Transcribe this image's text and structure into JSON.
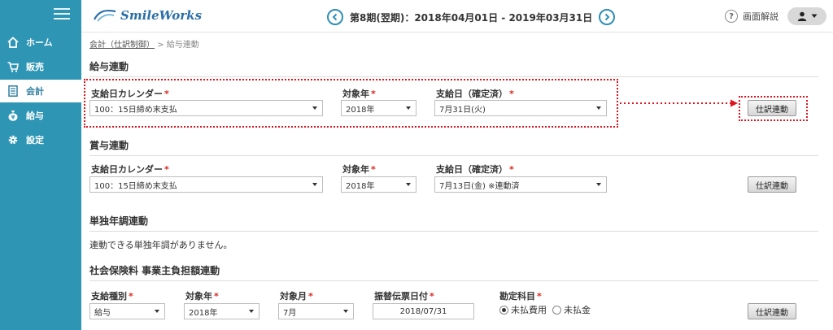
{
  "app": {
    "logo_text": "SmileWorks"
  },
  "header": {
    "period": "第8期(翌期)：2018年04月01日 - 2019年03月31日",
    "help_label": "画面解説",
    "help_glyph": "?"
  },
  "sidebar": {
    "items": [
      {
        "label": "ホーム",
        "icon": "home-icon"
      },
      {
        "label": "販売",
        "icon": "cart-icon"
      },
      {
        "label": "会計",
        "icon": "ledger-icon"
      },
      {
        "label": "給与",
        "icon": "money-bag-icon"
      },
      {
        "label": "設定",
        "icon": "gear-icon"
      }
    ],
    "active_index": 2
  },
  "breadcrumb": {
    "link": "会計（仕訳制御）",
    "separator": ">",
    "current": "給与連動"
  },
  "salary": {
    "title": "給与連動",
    "calendar_label": "支給日カレンダー",
    "calendar_value": "100：15日締め末支払",
    "year_label": "対象年",
    "year_value": "2018年",
    "payday_label": "支給日（確定済）",
    "payday_value": "7月31日(火)",
    "button": "仕訳連動"
  },
  "bonus": {
    "title": "賞与連動",
    "calendar_label": "支給日カレンダー",
    "calendar_value": "100：15日締め末支払",
    "year_label": "対象年",
    "year_value": "2018年",
    "payday_label": "支給日（確定済）",
    "payday_value": "7月13日(金) ※連動済",
    "button": "仕訳連動"
  },
  "year_end": {
    "title": "単独年調連動",
    "message": "連動できる単独年調がありません。"
  },
  "social": {
    "title": "社会保険料 事業主負担額連動",
    "type_label": "支給種別",
    "type_value": "給与",
    "year_label": "対象年",
    "year_value": "2018年",
    "month_label": "対象月",
    "month_value": "7月",
    "date_label": "振替伝票日付",
    "date_value": "2018/07/31",
    "account_label": "勘定科目",
    "account_options": [
      "未払費用",
      "未払金"
    ],
    "account_selected": 0,
    "button": "仕訳連動"
  },
  "required_mark": "*",
  "colors": {
    "sidebar": "#2e95b4",
    "accent": "#2e8fb2",
    "required": "#d9251b",
    "highlight": "#e0141e"
  }
}
